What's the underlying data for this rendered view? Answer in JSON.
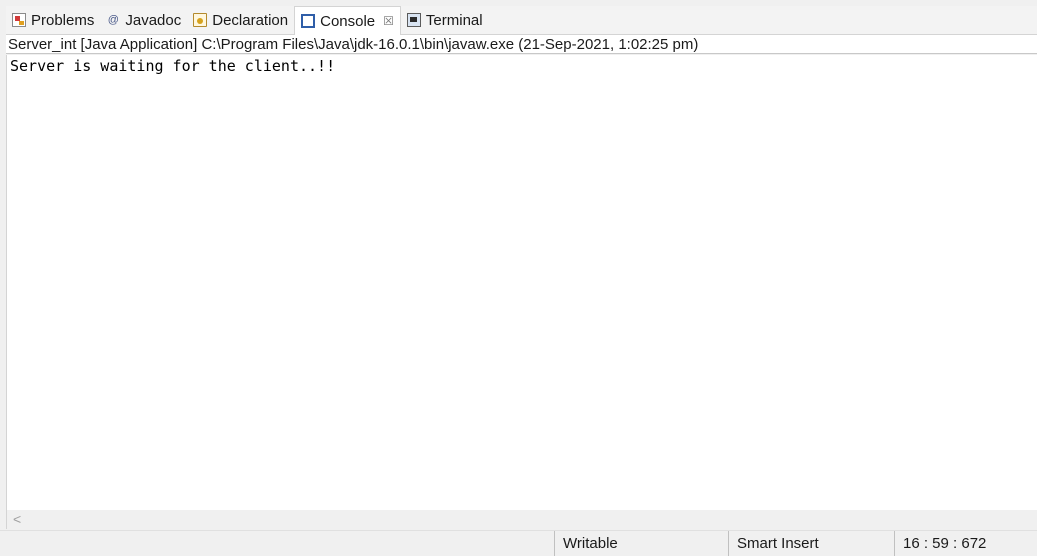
{
  "tabs": [
    {
      "label": "Problems",
      "icon": "problems-icon"
    },
    {
      "label": "Javadoc",
      "icon": "javadoc-icon"
    },
    {
      "label": "Declaration",
      "icon": "declaration-icon"
    },
    {
      "label": "Console",
      "icon": "console-icon",
      "active": true,
      "close_glyph": "☒"
    },
    {
      "label": "Terminal",
      "icon": "terminal-icon"
    }
  ],
  "javadoc_glyph": "@",
  "process_info": "Server_int [Java Application] C:\\Program Files\\Java\\jdk-16.0.1\\bin\\javaw.exe  (21-Sep-2021, 1:02:25 pm)",
  "console": {
    "lines": [
      "Server is waiting for the client..!!"
    ]
  },
  "scrollbar": {
    "left_arrow": "<"
  },
  "statusbar": {
    "mode": "Writable",
    "insert_mode": "Smart Insert",
    "position": "16 : 59 : 672"
  }
}
